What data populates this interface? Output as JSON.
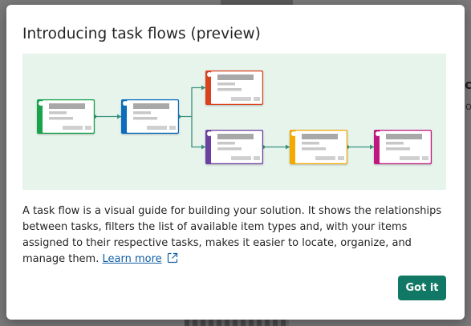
{
  "dialog": {
    "title": "Introducing task flows (preview)",
    "description": "A task flow is a visual guide for building your solution. It shows the relationships between tasks, filters the list of available item types and, with your items assigned to their respective tasks, makes it easier to locate, organize, and manage them.",
    "learn_more_label": "Learn more",
    "got_it_label": "Got it",
    "accent_color": "#117865",
    "link_color": "#115ea3"
  },
  "background": {
    "partial_text_1": "c",
    "partial_text_2": "o"
  },
  "illustration": {
    "background_color": "#e6f4ec",
    "connector_color": "#3a8f7d",
    "cards": [
      {
        "name": "card-green",
        "color": "#16a34a"
      },
      {
        "name": "card-blue",
        "color": "#0f6cbd"
      },
      {
        "name": "card-red",
        "color": "#d9421c"
      },
      {
        "name": "card-purple",
        "color": "#6b3fa0"
      },
      {
        "name": "card-yellow",
        "color": "#f2a900"
      },
      {
        "name": "card-magenta",
        "color": "#c0127f"
      }
    ]
  }
}
